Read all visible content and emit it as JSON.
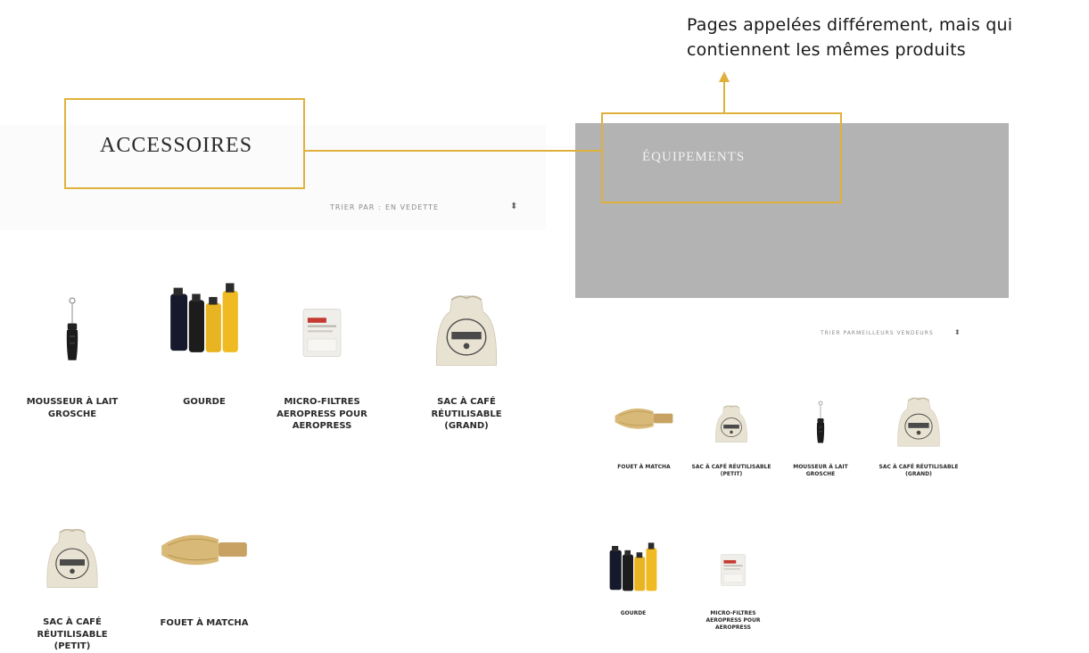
{
  "annotation": {
    "line1": "Pages appelées différement, mais qui",
    "line2": "contiennent les mêmes produits"
  },
  "left_page": {
    "title": "ACCESSOIRES",
    "sort_label": "TRIER PAR :",
    "sort_value": "EN VEDETTE",
    "products": [
      {
        "name": "MOUSSEUR À LAIT GROSCHE",
        "icon": "milk-frother"
      },
      {
        "name": "GOURDE",
        "icon": "water-bottles"
      },
      {
        "name": "MICRO-FILTRES AEROPRESS POUR AEROPRESS",
        "icon": "filter-pack"
      },
      {
        "name": "SAC À CAFÉ RÉUTILISABLE (GRAND)",
        "icon": "coffee-sack"
      },
      {
        "name": "SAC À CAFÉ RÉUTILISABLE (PETIT)",
        "icon": "coffee-sack-small"
      },
      {
        "name": "FOUET À MATCHA",
        "icon": "matcha-whisk"
      }
    ]
  },
  "right_page": {
    "title": "ÉQUIPEMENTS",
    "sort_label": "TRIER PAR :",
    "sort_value": "MEILLEURS VENDEURS",
    "products": [
      {
        "name": "FOUET À MATCHA",
        "icon": "matcha-whisk"
      },
      {
        "name": "SAC À CAFÉ RÉUTILISABLE (PETIT)",
        "icon": "coffee-sack-small"
      },
      {
        "name": "MOUSSEUR À LAIT GROSCHE",
        "icon": "milk-frother"
      },
      {
        "name": "SAC À CAFÉ RÉUTILISABLE (GRAND)",
        "icon": "coffee-sack"
      },
      {
        "name": "GOURDE",
        "icon": "water-bottles"
      },
      {
        "name": "MICRO-FILTRES AEROPRESS POUR AEROPRESS",
        "icon": "filter-pack"
      }
    ]
  },
  "colors": {
    "callout": "#e0b13a",
    "banner": "#b3b3b3",
    "text": "#2a2a2a"
  }
}
